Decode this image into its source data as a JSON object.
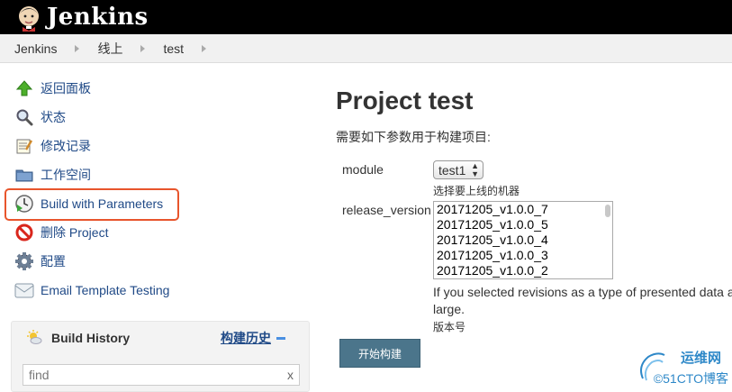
{
  "header": {
    "app_name": "Jenkins"
  },
  "breadcrumb": [
    {
      "label": "Jenkins"
    },
    {
      "label": "线上"
    },
    {
      "label": "test"
    }
  ],
  "sidebar": {
    "tasks": [
      {
        "label": "返回面板",
        "icon": "up-arrow-icon"
      },
      {
        "label": "状态",
        "icon": "magnifier-icon"
      },
      {
        "label": "修改记录",
        "icon": "notepad-icon"
      },
      {
        "label": "工作空间",
        "icon": "folder-icon"
      },
      {
        "label": "Build with Parameters",
        "icon": "build-clock-icon"
      },
      {
        "label": "删除 Project",
        "icon": "no-entry-icon"
      },
      {
        "label": "配置",
        "icon": "gear-icon"
      },
      {
        "label": "Email Template Testing",
        "icon": "envelope-icon"
      }
    ],
    "build_history": {
      "title": "Build History",
      "link": "构建历史",
      "search_placeholder": "find",
      "clear": "x"
    }
  },
  "main": {
    "title": "Project test",
    "description": "需要如下参数用于构建项目:",
    "params": {
      "module": {
        "label": "module",
        "selected": "test1",
        "hint": "选择要上线的机器"
      },
      "release_version": {
        "label": "release_version",
        "options": [
          "20171205_v1.0.0_7",
          "20171205_v1.0.0_5",
          "20171205_v1.0.0_4",
          "20171205_v1.0.0_3",
          "20171205_v1.0.0_2"
        ],
        "help_line1": "If you selected revisions as a type of presented data a",
        "help_line2": "large.",
        "hint": "版本号"
      }
    },
    "build_button": "开始构建"
  },
  "watermark": {
    "line1": "运维网",
    "line2": "©51CTO博客"
  },
  "colors": {
    "accent_red": "#e8552c",
    "link": "#204a87",
    "button": "#4b758b"
  }
}
